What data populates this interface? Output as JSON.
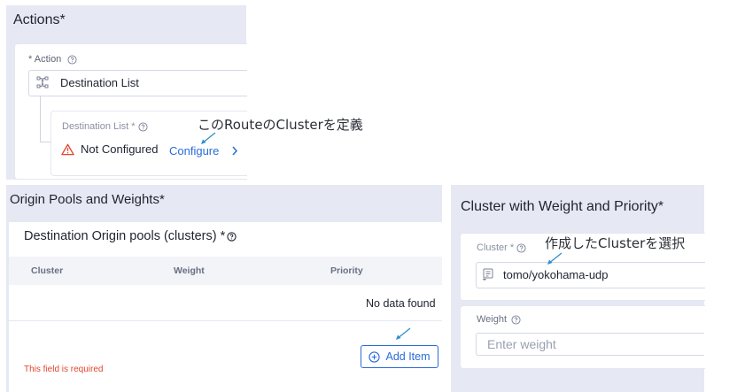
{
  "actions": {
    "title": "Actions",
    "required_mark": "*",
    "action_label": "* Action",
    "action_value": "Destination List",
    "destination_list_label": "Destination List *",
    "status_text": "Not Configured",
    "configure_link": "Configure",
    "annotation": "このRouteのClusterを定義"
  },
  "origin_pools": {
    "title": "Origin Pools and Weights",
    "required_mark": "*",
    "table_title": "Destination Origin pools (clusters) *",
    "columns": [
      "Cluster",
      "Weight",
      "Priority"
    ],
    "empty_text": "No data found",
    "add_button": "Add Item",
    "error_text": "This field is required"
  },
  "cluster_weight": {
    "title": "Cluster with Weight and Priority",
    "required_mark": "*",
    "cluster_label": "Cluster *",
    "cluster_value": "tomo/yokohama-udp",
    "annotation": "作成したClusterを選択",
    "weight_label": "Weight",
    "weight_placeholder": "Enter weight"
  },
  "colors": {
    "panel_bg": "#e6e9f3",
    "link": "#2a6cd7",
    "error": "#e2462e",
    "warning": "#e2462e",
    "arrow": "#2f8fd0"
  },
  "icons": [
    "help-circle-icon",
    "route-split-icon",
    "warning-triangle-icon",
    "chevron-right-icon",
    "plus-circle-icon",
    "list-select-icon",
    "pointer-arrow-icon"
  ]
}
